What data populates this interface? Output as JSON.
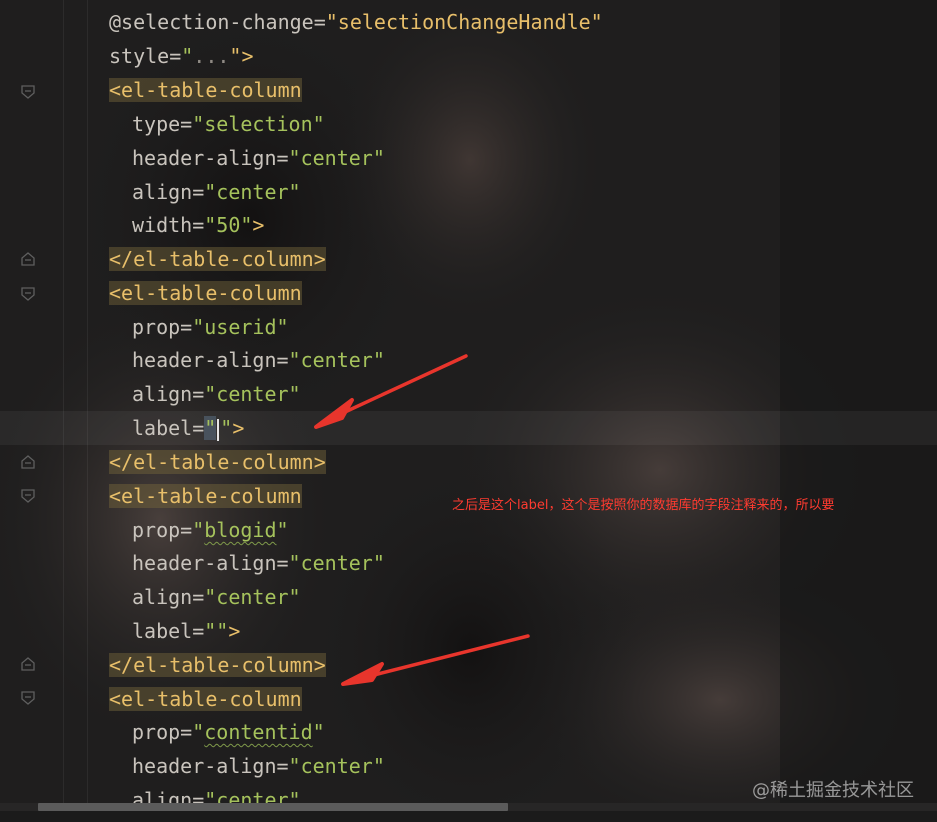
{
  "editor": {
    "lines": [
      {
        "segments": [
          {
            "t": "@selection-change=",
            "c": "attr"
          },
          {
            "t": "\"selectionChangeHandle\"",
            "c": "tag"
          }
        ]
      },
      {
        "segments": [
          {
            "t": "style=",
            "c": "attr"
          },
          {
            "t": "\"",
            "c": "str"
          },
          {
            "t": "...",
            "c": "muted"
          },
          {
            "t": "\">",
            "c": "tag"
          }
        ]
      },
      {
        "segments": [
          {
            "t": "<el-table-column",
            "c": "tag-hl"
          }
        ]
      },
      {
        "segments": [
          {
            "t": "type=",
            "c": "attr"
          },
          {
            "t": "\"selection\"",
            "c": "str"
          }
        ]
      },
      {
        "segments": [
          {
            "t": "header-align=",
            "c": "attr"
          },
          {
            "t": "\"center\"",
            "c": "str"
          }
        ]
      },
      {
        "segments": [
          {
            "t": "align=",
            "c": "attr"
          },
          {
            "t": "\"center\"",
            "c": "str"
          }
        ]
      },
      {
        "segments": [
          {
            "t": "width=",
            "c": "attr"
          },
          {
            "t": "\"50\"",
            "c": "str"
          },
          {
            "t": ">",
            "c": "tag"
          }
        ]
      },
      {
        "segments": [
          {
            "t": "</el-table-column>",
            "c": "tag-hl"
          }
        ]
      },
      {
        "segments": [
          {
            "t": "<el-table-column",
            "c": "tag-hl"
          }
        ]
      },
      {
        "segments": [
          {
            "t": "prop=",
            "c": "attr"
          },
          {
            "t": "\"userid\"",
            "c": "str"
          }
        ]
      },
      {
        "segments": [
          {
            "t": "header-align=",
            "c": "attr"
          },
          {
            "t": "\"center\"",
            "c": "str"
          }
        ]
      },
      {
        "segments": [
          {
            "t": "align=",
            "c": "attr"
          },
          {
            "t": "\"center\"",
            "c": "str"
          }
        ]
      },
      {
        "segments": [
          {
            "t": "label=",
            "c": "attr"
          },
          {
            "t": "\"",
            "c": "str caret-box"
          },
          {
            "t": "\"",
            "c": "str"
          },
          {
            "t": ">",
            "c": "tag"
          }
        ]
      },
      {
        "segments": [
          {
            "t": "</el-table-column>",
            "c": "tag-hl"
          }
        ]
      },
      {
        "segments": [
          {
            "t": "<el-table-column",
            "c": "tag-hl"
          }
        ]
      },
      {
        "segments": [
          {
            "t": "prop=",
            "c": "attr"
          },
          {
            "t": "\"",
            "c": "str"
          },
          {
            "t": "blogid",
            "c": "str squig"
          },
          {
            "t": "\"",
            "c": "str"
          }
        ]
      },
      {
        "segments": [
          {
            "t": "header-align=",
            "c": "attr"
          },
          {
            "t": "\"center\"",
            "c": "str"
          }
        ]
      },
      {
        "segments": [
          {
            "t": "align=",
            "c": "attr"
          },
          {
            "t": "\"center\"",
            "c": "str"
          }
        ]
      },
      {
        "segments": [
          {
            "t": "label=",
            "c": "attr"
          },
          {
            "t": "\"\"",
            "c": "str"
          },
          {
            "t": ">",
            "c": "tag"
          }
        ]
      },
      {
        "segments": [
          {
            "t": "</el-table-column>",
            "c": "tag-hl"
          }
        ]
      },
      {
        "segments": [
          {
            "t": "<el-table-column",
            "c": "tag-hl"
          }
        ]
      },
      {
        "segments": [
          {
            "t": "prop=",
            "c": "attr"
          },
          {
            "t": "\"",
            "c": "str"
          },
          {
            "t": "contentid",
            "c": "str squig"
          },
          {
            "t": "\"",
            "c": "str"
          }
        ]
      },
      {
        "segments": [
          {
            "t": "header-align=",
            "c": "attr"
          },
          {
            "t": "\"center\"",
            "c": "str"
          }
        ]
      },
      {
        "segments": [
          {
            "t": "align=",
            "c": "attr"
          },
          {
            "t": "\"center\"",
            "c": "str"
          }
        ]
      }
    ]
  },
  "annotation": {
    "text": "之后是这个label，这个是按照你的数据库的字段注释来的，所以要",
    "color": "#ff3b30"
  },
  "watermark": {
    "text": "@稀土掘金技术社区"
  },
  "icons": {
    "fold": "fold-marker-icon",
    "arrow": "red-arrow-icon"
  }
}
